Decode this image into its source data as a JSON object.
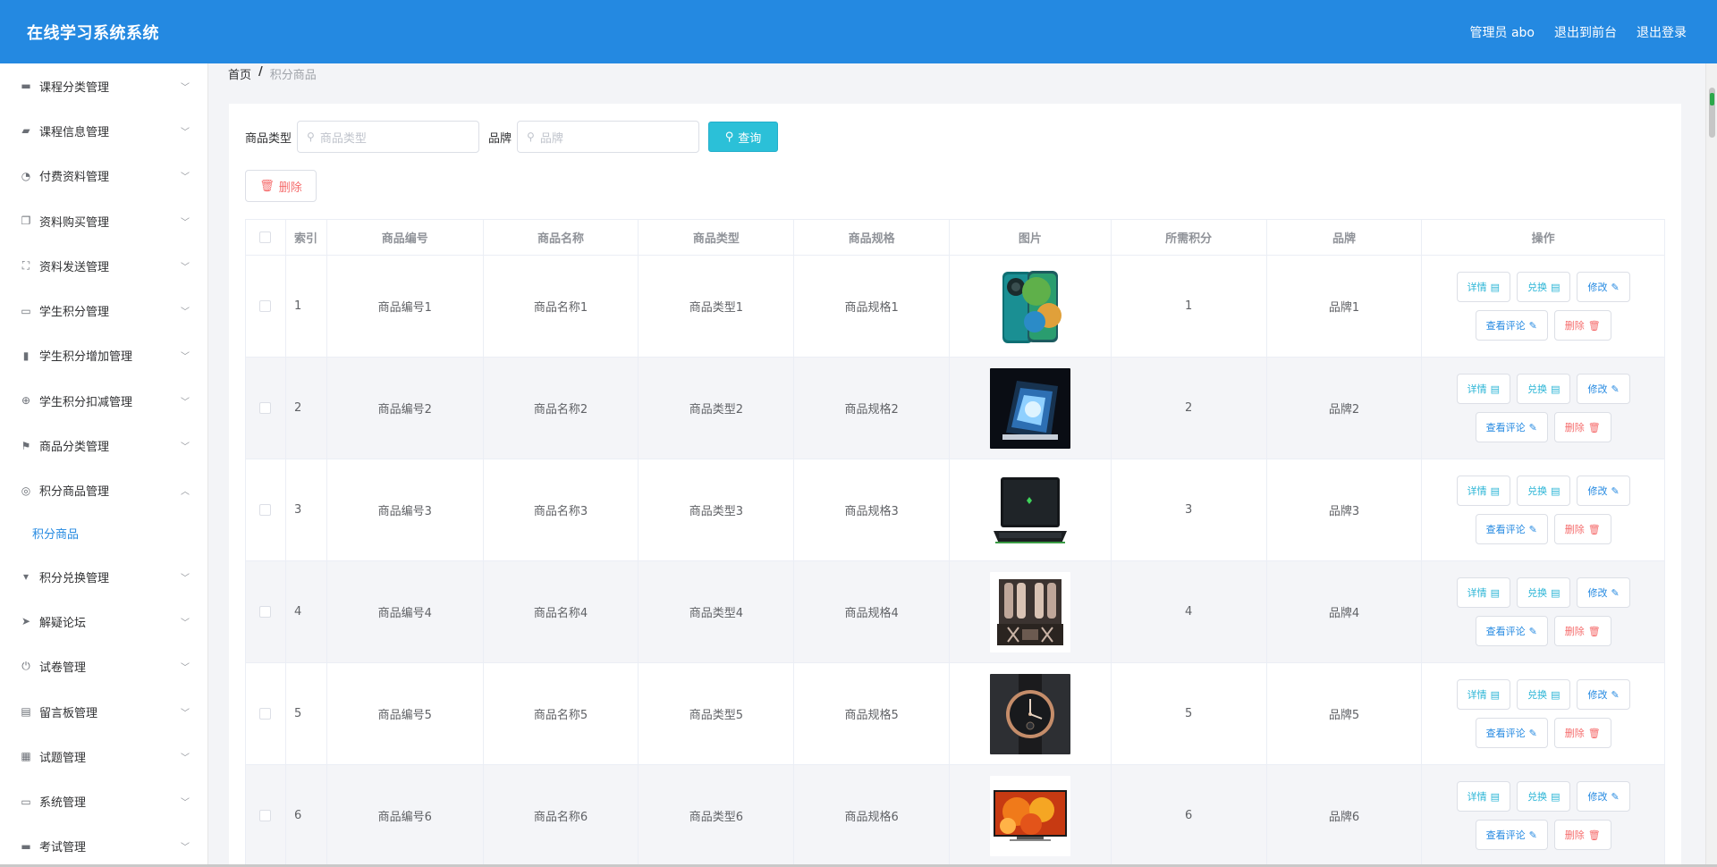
{
  "header": {
    "app_title": "在线学习系统系统",
    "admin_label": "管理员 abo",
    "back_front": "退出到前台",
    "logout": "退出登录"
  },
  "sidebar": {
    "items": [
      {
        "label": "课程分类管理",
        "icon": "chat-icon",
        "glyph": "▬"
      },
      {
        "label": "课程信息管理",
        "icon": "thumb-up-icon",
        "glyph": "▰"
      },
      {
        "label": "付费资料管理",
        "icon": "dashboard-icon",
        "glyph": "◔"
      },
      {
        "label": "资料购买管理",
        "icon": "copy-icon",
        "glyph": "❐"
      },
      {
        "label": "资料发送管理",
        "icon": "fullscreen-icon",
        "glyph": "⛶"
      },
      {
        "label": "学生积分管理",
        "icon": "id-card-icon",
        "glyph": "▭"
      },
      {
        "label": "学生积分增加管理",
        "icon": "mic-icon",
        "glyph": "▮"
      },
      {
        "label": "学生积分扣减管理",
        "icon": "basketball-icon",
        "glyph": "⊕"
      },
      {
        "label": "商品分类管理",
        "icon": "flag-icon",
        "glyph": "⚑"
      },
      {
        "label": "积分商品管理",
        "icon": "compass-icon",
        "glyph": "◎",
        "expanded": true
      },
      {
        "label": "积分兑换管理",
        "icon": "cup-icon",
        "glyph": "▾"
      },
      {
        "label": "解疑论坛",
        "icon": "send-icon",
        "glyph": "➤"
      },
      {
        "label": "试卷管理",
        "icon": "power-icon",
        "glyph": "⏻"
      },
      {
        "label": "留言板管理",
        "icon": "clipboard-icon",
        "glyph": "▤"
      },
      {
        "label": "试题管理",
        "icon": "grid-icon",
        "glyph": "▦"
      },
      {
        "label": "系统管理",
        "icon": "message-icon",
        "glyph": "▭"
      },
      {
        "label": "考试管理",
        "icon": "suitcase-icon",
        "glyph": "▬"
      }
    ],
    "sub_item": "积分商品"
  },
  "breadcrumb": {
    "home": "首页",
    "sep": "/",
    "current": "积分商品"
  },
  "search": {
    "type_label": "商品类型",
    "type_placeholder": "商品类型",
    "brand_label": "品牌",
    "brand_placeholder": "品牌",
    "query_button": "查询"
  },
  "delete_button": "删除",
  "table": {
    "headers": {
      "index": "索引",
      "code": "商品编号",
      "name": "商品名称",
      "type": "商品类型",
      "spec": "商品规格",
      "image": "图片",
      "points": "所需积分",
      "brand": "品牌",
      "ops": "操作"
    },
    "ops": {
      "detail": "详情",
      "redeem": "兑换",
      "edit": "修改",
      "review": "查看评论",
      "delete": "删除"
    },
    "rows": [
      {
        "index": "1",
        "code": "商品编号1",
        "name": "商品名称1",
        "type": "商品类型1",
        "spec": "商品规格1",
        "points": "1",
        "brand": "品牌1",
        "image": "phone-image"
      },
      {
        "index": "2",
        "code": "商品编号2",
        "name": "商品名称2",
        "type": "商品类型2",
        "spec": "商品规格2",
        "points": "2",
        "brand": "品牌2",
        "image": "gaming-pc-image"
      },
      {
        "index": "3",
        "code": "商品编号3",
        "name": "商品名称3",
        "type": "商品类型3",
        "spec": "商品规格3",
        "points": "3",
        "brand": "品牌3",
        "image": "laptop-image"
      },
      {
        "index": "4",
        "code": "商品编号4",
        "name": "商品名称4",
        "type": "商品类型4",
        "spec": "商品规格4",
        "points": "4",
        "brand": "品牌4",
        "image": "amplifier-image"
      },
      {
        "index": "5",
        "code": "商品编号5",
        "name": "商品名称5",
        "type": "商品类型5",
        "spec": "商品规格5",
        "points": "5",
        "brand": "品牌5",
        "image": "watch-image"
      },
      {
        "index": "6",
        "code": "商品编号6",
        "name": "商品名称6",
        "type": "商品类型6",
        "spec": "商品规格6",
        "points": "6",
        "brand": "品牌6",
        "image": "tv-image"
      }
    ]
  },
  "colors": {
    "header_bg": "#2489e1",
    "accent": "#2bc0d8",
    "danger": "#f56c6c"
  }
}
